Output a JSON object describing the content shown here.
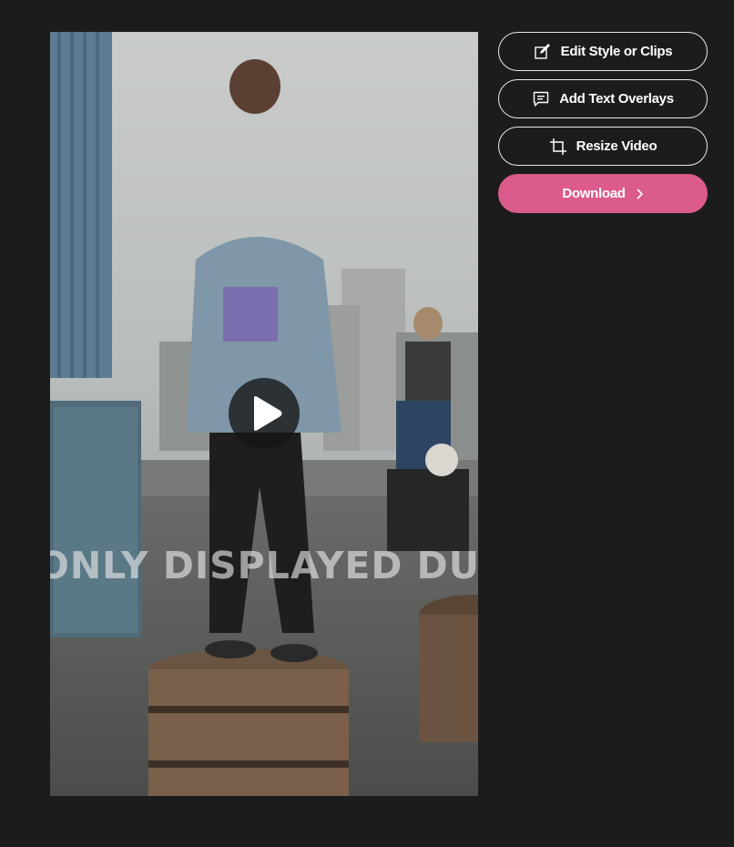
{
  "video": {
    "watermark_text": "ONLY DISPLAYED DU"
  },
  "actions": {
    "edit_style_label": "Edit Style or Clips",
    "add_text_label": "Add Text Overlays",
    "resize_label": "Resize Video",
    "download_label": "Download"
  },
  "colors": {
    "page_background": "#1c1c1c",
    "download_button": "#dc5b8d",
    "button_border": "#e8e8e8"
  },
  "icons": {
    "edit": "edit-pencil-icon",
    "text": "comment-icon",
    "resize": "crop-icon",
    "download": "chevron-right-icon",
    "play": "play-icon"
  }
}
